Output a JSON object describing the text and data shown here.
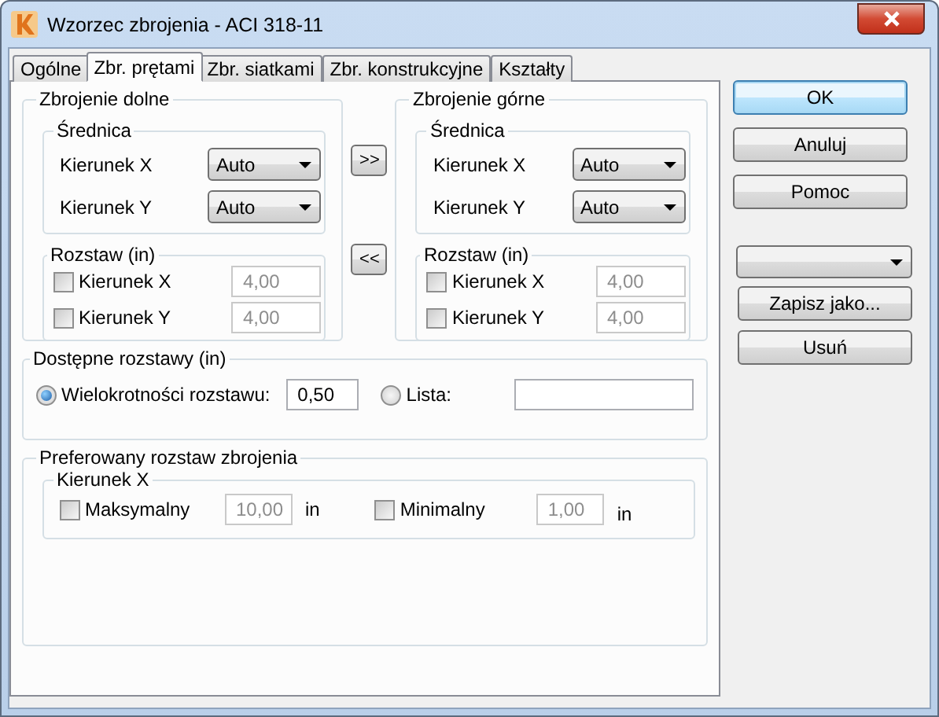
{
  "window": {
    "title": "Wzorzec zbrojenia - ACI 318-11"
  },
  "tabs": [
    {
      "label": "Ogólne",
      "selected": false
    },
    {
      "label": "Zbr. prętami",
      "selected": true
    },
    {
      "label": "Zbr. siatkami",
      "selected": false
    },
    {
      "label": "Zbr. konstrukcyjne",
      "selected": false
    },
    {
      "label": "Kształty",
      "selected": false
    }
  ],
  "bottom_reinforcement": {
    "title": "Zbrojenie dolne",
    "diameter": {
      "title": "Średnica",
      "rows": [
        {
          "label": "Kierunek X",
          "value": "Auto"
        },
        {
          "label": "Kierunek Y",
          "value": "Auto"
        }
      ]
    },
    "spacing": {
      "title": "Rozstaw (in)",
      "rows": [
        {
          "label": "Kierunek X",
          "checked": false,
          "value": "4,00"
        },
        {
          "label": "Kierunek Y",
          "checked": false,
          "value": "4,00"
        }
      ]
    }
  },
  "copy_buttons": [
    ">>",
    "<<"
  ],
  "top_reinforcement": {
    "title": "Zbrojenie górne",
    "diameter": {
      "title": "Średnica",
      "rows": [
        {
          "label": "Kierunek X",
          "value": "Auto"
        },
        {
          "label": "Kierunek Y",
          "value": "Auto"
        }
      ]
    },
    "spacing": {
      "title": "Rozstaw (in)",
      "rows": [
        {
          "label": "Kierunek X",
          "checked": false,
          "value": "4,00"
        },
        {
          "label": "Kierunek Y",
          "checked": false,
          "value": "4,00"
        }
      ]
    }
  },
  "available_spacings": {
    "title": "Dostępne rozstawy (in)",
    "options": [
      {
        "label": "Wielokrotności rozstawu:",
        "selected": true,
        "value": "0,50"
      },
      {
        "label": "Lista:",
        "selected": false
      }
    ]
  },
  "preferred_spacing": {
    "title": "Preferowany rozstaw zbrojenia",
    "group": {
      "title": "Kierunek X",
      "items": [
        {
          "label": "Maksymalny",
          "checked": false,
          "value": "10,00",
          "unit": "in"
        },
        {
          "label": "Minimalny",
          "checked": false,
          "value": "1,00",
          "unit": "in"
        }
      ]
    }
  },
  "buttons": [
    {
      "label": "OK",
      "default": true
    },
    {
      "label": "Anuluj",
      "default": false
    },
    {
      "label": "Pomoc",
      "default": false
    }
  ],
  "template_buttons": [
    "Zapisz jako...",
    "Usuń"
  ]
}
